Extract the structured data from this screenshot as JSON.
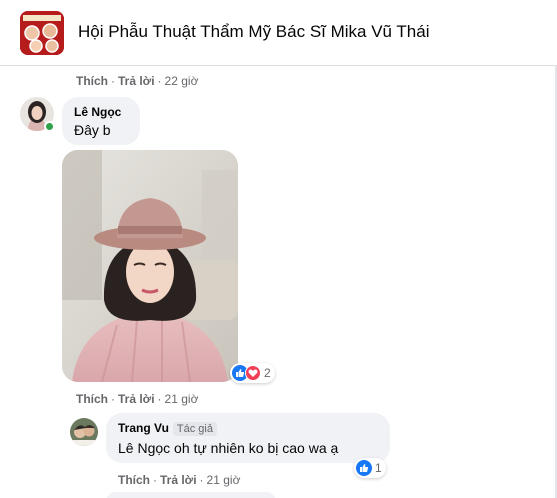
{
  "header": {
    "group_name": "Hội Phẫu Thuật Thẩm Mỹ Bác Sĩ Mika Vũ Thái"
  },
  "top_comment_meta": {
    "like": "Thích",
    "reply": "Trả lời",
    "time": "22 giờ"
  },
  "comment_1": {
    "author": "Lê Ngọc",
    "text": "Đây b",
    "reaction_count": "2",
    "meta": {
      "like": "Thích",
      "reply": "Trả lời",
      "time": "21 giờ"
    }
  },
  "reply_1": {
    "author": "Trang Vu",
    "badge": "Tác giả",
    "mention": "Lê Ngọc",
    "text": "oh tự nhiên ko bị cao wa ạ",
    "reaction_count": "1",
    "meta": {
      "like": "Thích",
      "reply": "Trả lời",
      "time": "21 giờ"
    }
  },
  "separator": "·",
  "colors": {
    "bubble": "#f0f2f5",
    "meta_text": "#65676b",
    "like_blue": "#1877f2",
    "love_red": "#f33e58",
    "online_green": "#31a24c"
  },
  "icons": [
    "like-icon",
    "love-icon"
  ]
}
